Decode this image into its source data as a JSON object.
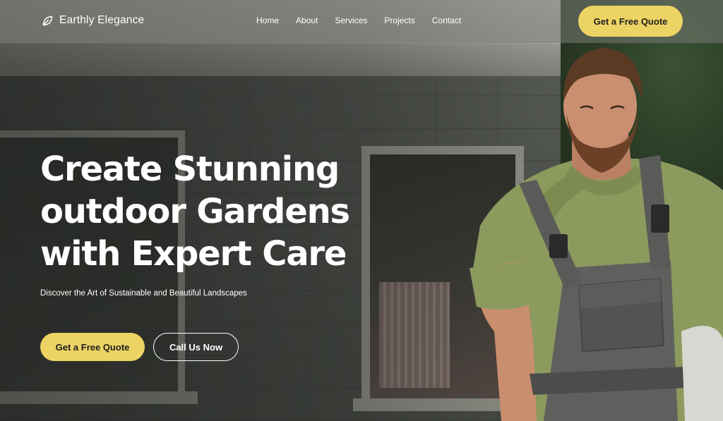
{
  "brand": {
    "name": "Earthly Elegance",
    "icon": "leaf-icon"
  },
  "nav": {
    "items": [
      {
        "label": "Home"
      },
      {
        "label": "About"
      },
      {
        "label": "Services"
      },
      {
        "label": "Projects"
      },
      {
        "label": "Contact"
      }
    ],
    "cta_label": "Get a Free Quote"
  },
  "hero": {
    "headline_lines": [
      "Create Stunning",
      "outdoor Gardens",
      "with Expert Care"
    ],
    "subheadline": "Discover the Art of Sustainable and Beautiful Landscapes",
    "primary_cta": "Get a Free Quote",
    "secondary_cta": "Call Us Now"
  },
  "colors": {
    "accent": "#ecd363",
    "text": "#ffffff",
    "button_text": "#1f1f1f"
  }
}
